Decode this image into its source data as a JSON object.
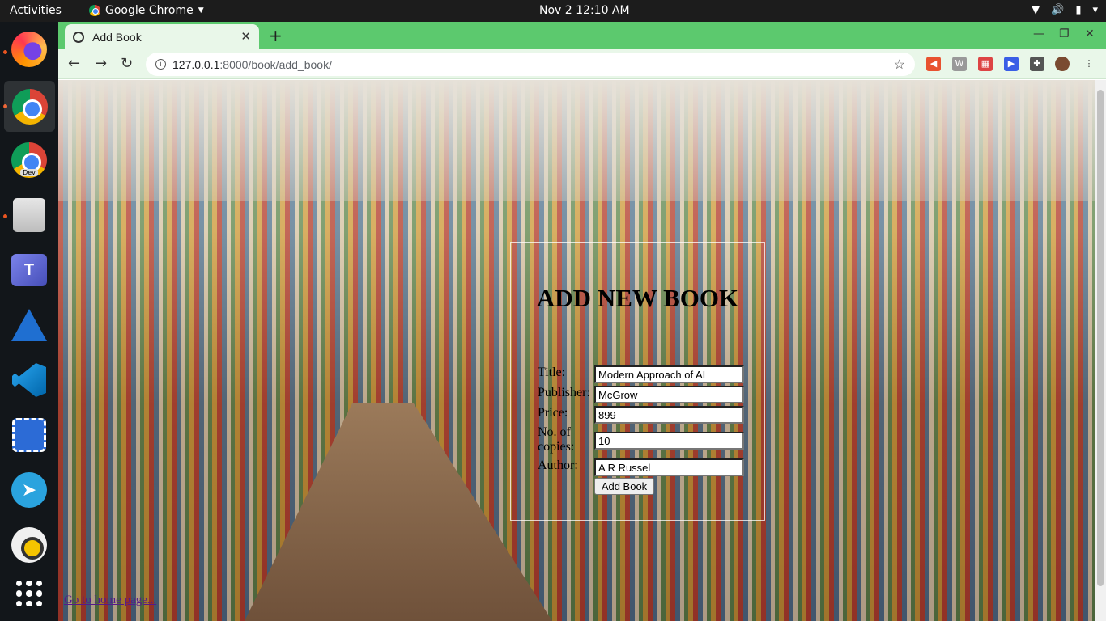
{
  "topbar": {
    "activities": "Activities",
    "app_name": "Google Chrome",
    "clock": "Nov 2  12:10 AM"
  },
  "dock": {
    "items": [
      "firefox-icon",
      "chrome-icon",
      "chrome-dev-icon",
      "files-icon",
      "teams-icon",
      "wireshark-icon",
      "vscode-icon",
      "screenshot-icon",
      "telegram-icon",
      "rhythmbox-icon",
      "show-apps-icon"
    ],
    "dev_badge": "Dev"
  },
  "browser": {
    "tab_title": "Add Book",
    "url_host": "127.0.0.1",
    "url_path": ":8000/book/add_book/"
  },
  "form": {
    "heading": "ADD NEW BOOK",
    "fields": [
      {
        "label": "Title:",
        "value": "Modern Approach of AI"
      },
      {
        "label": "Publisher:",
        "value": "McGrow"
      },
      {
        "label": "Price:",
        "value": "899"
      },
      {
        "label": "No. of copies:",
        "value": "10"
      },
      {
        "label": "Author:",
        "value": "A R Russel"
      }
    ],
    "submit_label": "Add Book"
  },
  "footer_link": "Go to home page..."
}
